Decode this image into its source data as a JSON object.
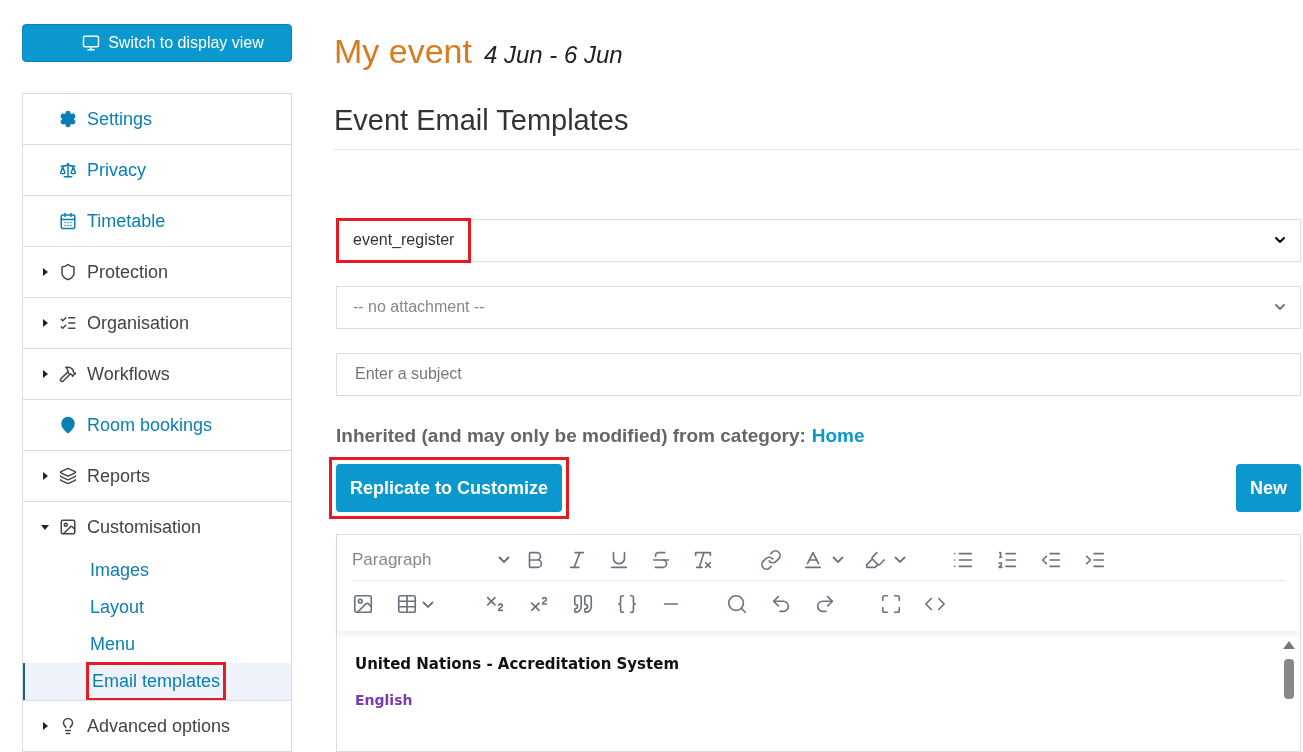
{
  "switch_button": {
    "label": "Switch to display view"
  },
  "sidebar": {
    "items": [
      {
        "kind": "link",
        "label": "Settings"
      },
      {
        "kind": "link",
        "label": "Privacy"
      },
      {
        "kind": "link",
        "label": "Timetable"
      },
      {
        "kind": "group",
        "label": "Protection",
        "expanded": false
      },
      {
        "kind": "group",
        "label": "Organisation",
        "expanded": false
      },
      {
        "kind": "group",
        "label": "Workflows",
        "expanded": false
      },
      {
        "kind": "link",
        "label": "Room bookings"
      },
      {
        "kind": "group",
        "label": "Reports",
        "expanded": false
      },
      {
        "kind": "group",
        "label": "Customisation",
        "expanded": true,
        "children": [
          {
            "label": "Images",
            "selected": false,
            "highlighted": false
          },
          {
            "label": "Layout",
            "selected": false,
            "highlighted": false
          },
          {
            "label": "Menu",
            "selected": false,
            "highlighted": false
          },
          {
            "label": "Email templates",
            "selected": true,
            "highlighted": true
          }
        ]
      },
      {
        "kind": "group",
        "label": "Advanced options",
        "expanded": false
      }
    ]
  },
  "header": {
    "title": "My event",
    "dates": "4 Jun - 6 Jun"
  },
  "section_title": "Event Email Templates",
  "template_select": {
    "value": "event_register",
    "highlighted": true
  },
  "attachment_select": {
    "placeholder": "-- no attachment --"
  },
  "subject_field": {
    "placeholder": "Enter a subject"
  },
  "inherited_note": {
    "text": "Inherited (and may only be modified) from category:",
    "link": "Home"
  },
  "replicate_button": {
    "label": "Replicate to Customize",
    "highlighted": true
  },
  "new_button": {
    "label": "New"
  },
  "editor": {
    "format_select": "Paragraph",
    "content": [
      {
        "kind": "heading",
        "text": "United Nations - Accreditation System"
      },
      {
        "kind": "language",
        "text": "English"
      }
    ]
  }
}
